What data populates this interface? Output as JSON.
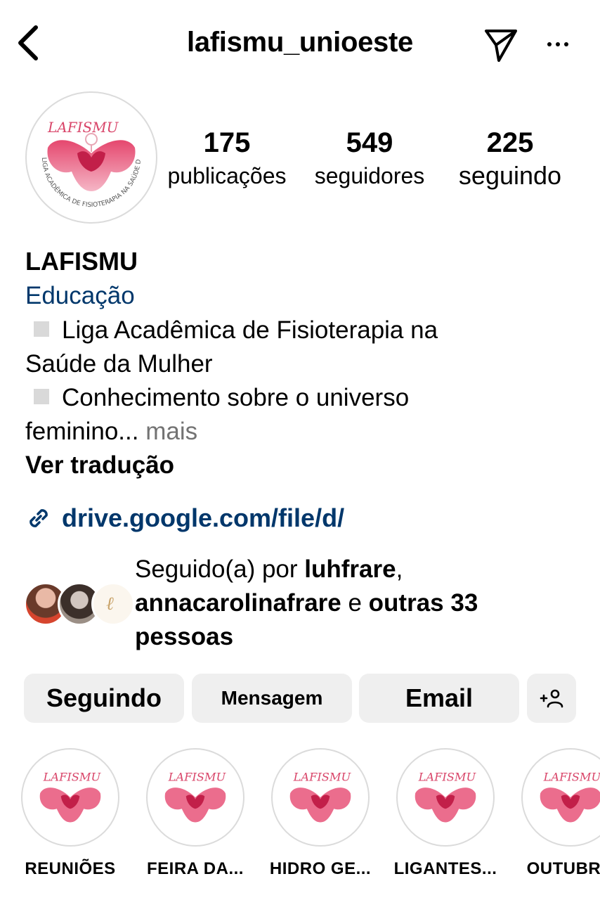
{
  "header": {
    "username": "lafismu_unioeste",
    "back_icon": "chevron-left-icon",
    "send_icon": "paper-plane-icon",
    "more_icon": "more-horizontal-icon"
  },
  "profile": {
    "avatar_text_top": "LAFISMU",
    "avatar_text_ring": "LIGA ACADÊMICA DE FISIOTERAPIA NA SAÚDE DA MULHER UNIOESTE"
  },
  "stats": {
    "posts_count": "175",
    "posts_label": "publicações",
    "followers_count": "549",
    "followers_label": "seguidores",
    "following_count": "225",
    "following_label": "seguindo"
  },
  "bio": {
    "name": "LAFISMU",
    "category": "Educação",
    "line1a": "Liga Acadêmica de Fisioterapia na",
    "line1b": "Saúde da Mulher",
    "line2a": "Conhecimento sobre o universo",
    "line2b": "feminino...",
    "more": " mais",
    "translate": "Ver tradução"
  },
  "link": {
    "url": "drive.google.com/file/d/",
    "icon": "link-icon"
  },
  "followed_by": {
    "prefix": "Seguido(a) por ",
    "user1": "luhfrare",
    "comma": ",",
    "user2": "annacarolinafrare",
    "conj": " e ",
    "others": "outras 33 pessoas"
  },
  "actions": {
    "following": "Seguindo",
    "message": "Mensagem",
    "email": "Email",
    "add_icon": "add-person-icon"
  },
  "highlights": [
    {
      "label": "REUNIÕES"
    },
    {
      "label": "FEIRA DA..."
    },
    {
      "label": "HIDRO GE..."
    },
    {
      "label": "LIGANTES..."
    },
    {
      "label": "OUTUBRO"
    }
  ],
  "colors": {
    "link_blue": "#00376b",
    "button_gray": "#efefef",
    "brand_pink": "#d9466a"
  }
}
